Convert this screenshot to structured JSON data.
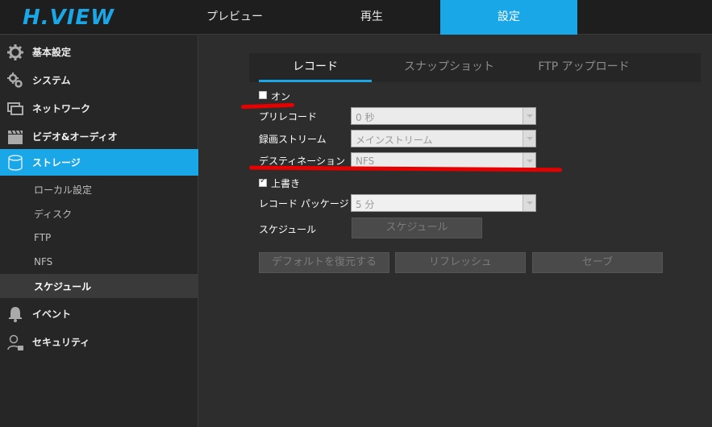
{
  "header": {
    "logo": "H.VIEW",
    "tabs": [
      {
        "label": "プレビュー"
      },
      {
        "label": "再生"
      },
      {
        "label": "設定"
      }
    ]
  },
  "sidebar": {
    "items": [
      {
        "label": "基本設定",
        "icon": "gear-icon"
      },
      {
        "label": "システム",
        "icon": "gears-icon"
      },
      {
        "label": "ネットワーク",
        "icon": "network-icon"
      },
      {
        "label": "ビデオ&オーディオ",
        "icon": "clapperboard-icon"
      },
      {
        "label": "ストレージ",
        "icon": "storage-icon"
      }
    ],
    "subitems": [
      {
        "label": "ローカル設定"
      },
      {
        "label": "ディスク"
      },
      {
        "label": "FTP"
      },
      {
        "label": "NFS"
      },
      {
        "label": "スケジュール"
      }
    ],
    "items2": [
      {
        "label": "イベント",
        "icon": "bell-icon"
      },
      {
        "label": "セキュリティ",
        "icon": "user-lock-icon"
      }
    ]
  },
  "content": {
    "subtabs": [
      {
        "label": "レコード"
      },
      {
        "label": "スナップショット"
      },
      {
        "label": "FTP アップロード"
      }
    ],
    "on_label": "オン",
    "prerecord_label": "プリレコード",
    "prerecord_value": "0 秒",
    "stream_label": "録画ストリーム",
    "stream_value": "メインストリーム",
    "destination_label": "デスティネーション",
    "destination_value": "NFS",
    "overwrite_label": "上書き",
    "package_label": "レコード パッケージ",
    "package_value": "5 分",
    "schedule_label": "スケジュール",
    "schedule_button": "スケジュール",
    "buttons": {
      "default": "デフォルトを復元する",
      "refresh": "リフレッシュ",
      "save": "セーブ"
    }
  },
  "colors": {
    "accent": "#1aa7e8",
    "annotation": "#e60000"
  }
}
